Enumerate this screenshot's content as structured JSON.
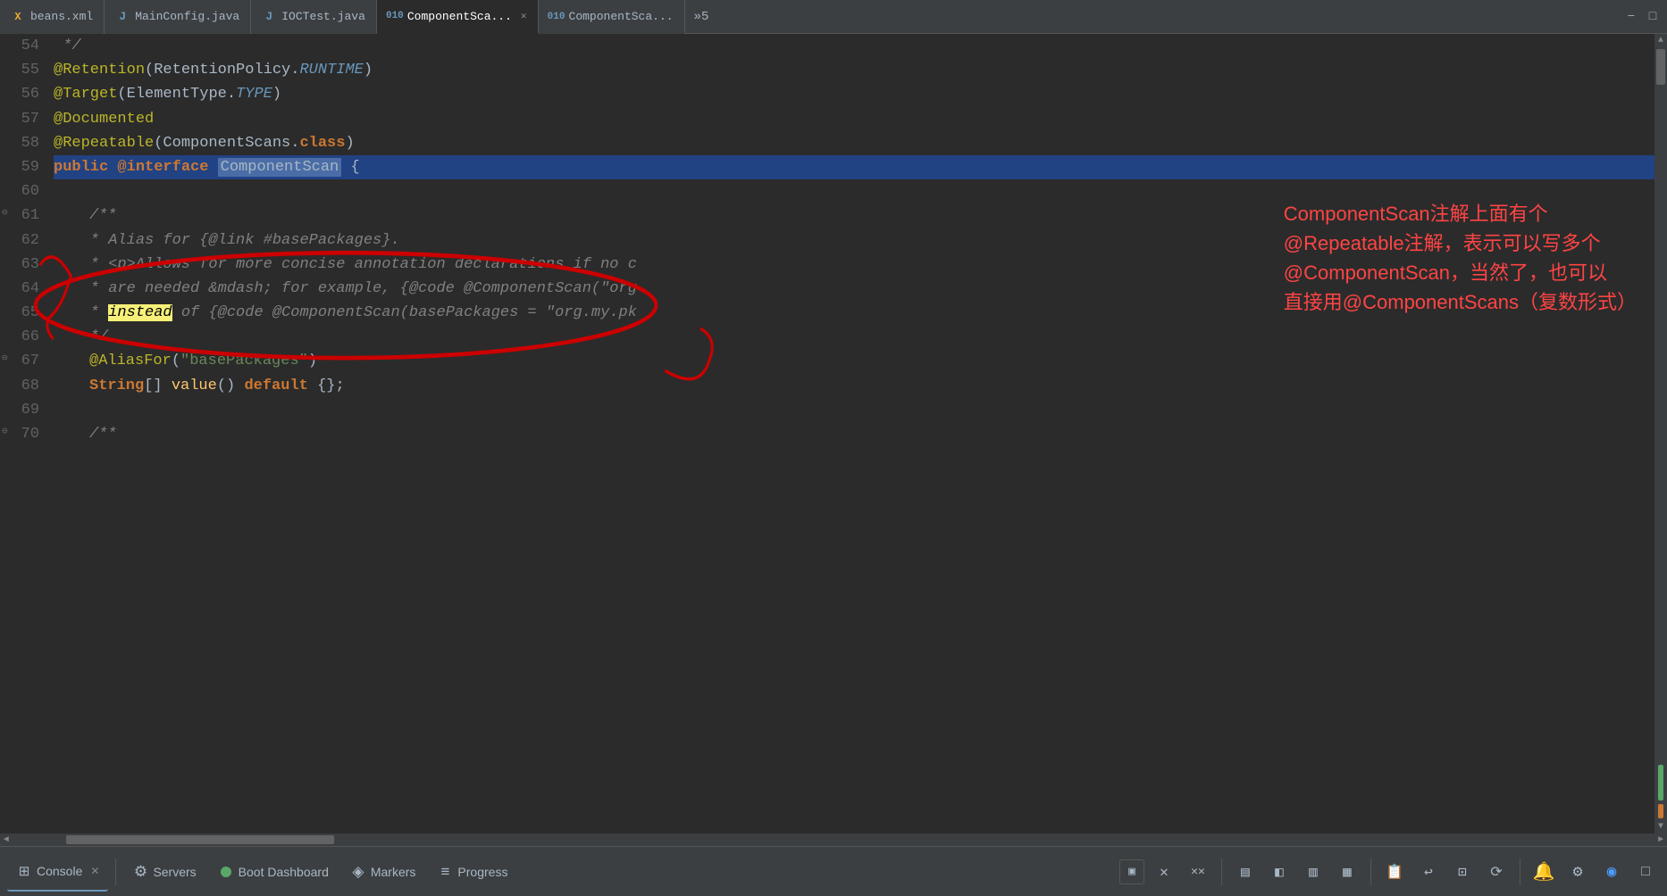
{
  "tabs": [
    {
      "id": "beans-xml",
      "label": "beans.xml",
      "icon": "X",
      "active": false,
      "closable": false
    },
    {
      "id": "mainconfig-java",
      "label": "MainConfig.java",
      "icon": "J",
      "active": false,
      "closable": false
    },
    {
      "id": "ioctest-java",
      "label": "IOCTest.java",
      "icon": "J",
      "active": false,
      "closable": false
    },
    {
      "id": "componentscan-1",
      "label": "ComponentSca...",
      "icon": "J",
      "active": true,
      "closable": true
    },
    {
      "id": "componentscan-2",
      "label": "ComponentSca...",
      "icon": "J",
      "active": false,
      "closable": false
    }
  ],
  "tab_overflow": "»5",
  "win_btns": [
    "−",
    "□"
  ],
  "code_lines": [
    {
      "num": "54",
      "content": " */",
      "type": "comment_end"
    },
    {
      "num": "55",
      "content": "@Retention(RetentionPolicy.RUNTIME)",
      "type": "annotation_line"
    },
    {
      "num": "56",
      "content": "@Target(ElementType.TYPE)",
      "type": "annotation_line2"
    },
    {
      "num": "57",
      "content": "@Documented",
      "type": "annotation_simple"
    },
    {
      "num": "58",
      "content": "@Repeatable(ComponentScans.class)",
      "type": "repeatable_line"
    },
    {
      "num": "59",
      "content": "public @interface ComponentScan {",
      "type": "interface_line"
    },
    {
      "num": "60",
      "content": "",
      "type": "empty"
    },
    {
      "num": "61",
      "content": "   /**",
      "type": "comment_start",
      "fold": true
    },
    {
      "num": "62",
      "content": "    * Alias for {@link #basePackages}.",
      "type": "comment_body"
    },
    {
      "num": "63",
      "content": "    * <p>Allows for more concise annotation declarations if no c",
      "type": "comment_body"
    },
    {
      "num": "64",
      "content": "    * are needed &mdash; for example, {@code @ComponentScan(\"org",
      "type": "comment_body"
    },
    {
      "num": "65",
      "content": "    * instead of {@code @ComponentScan(basePackages = \"org.my.pk",
      "type": "comment_body"
    },
    {
      "num": "66",
      "content": "    */",
      "type": "comment_end2"
    },
    {
      "num": "67",
      "content": "   @AliasFor(\"basePackages\")",
      "type": "aliasfor_line",
      "fold": true
    },
    {
      "num": "68",
      "content": "   String[] value() default {};",
      "type": "method_line"
    },
    {
      "num": "69",
      "content": "",
      "type": "empty"
    },
    {
      "num": "70",
      "content": "   /**",
      "type": "comment_start2",
      "fold": true
    }
  ],
  "annotation_comment": {
    "line1": "ComponentScan注解上面有个",
    "line2": "@Repeatable注解，表示可以写多个",
    "line3": "@ComponentScan，当然了，也可以",
    "line4": "直接用@ComponentScans（复数形式）"
  },
  "bottom_bar": {
    "items": [
      {
        "id": "console",
        "label": "Console",
        "icon": "⊞",
        "active": true,
        "has_close": true
      },
      {
        "id": "servers",
        "label": "Servers",
        "icon": "⚙"
      },
      {
        "id": "boot-dashboard",
        "label": "Boot Dashboard",
        "icon": "●"
      },
      {
        "id": "markers",
        "label": "Markers",
        "icon": "◈"
      },
      {
        "id": "progress",
        "label": "Progress",
        "icon": "≡"
      }
    ],
    "right_buttons": [
      "▣",
      "✕",
      "✕✕",
      "▤",
      "◧",
      "▥",
      "▦",
      "📋",
      "↩",
      "⊡",
      "⟳",
      "📌"
    ]
  }
}
